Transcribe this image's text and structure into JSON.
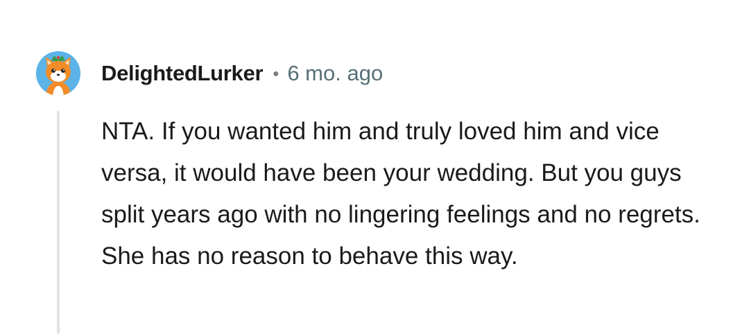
{
  "comment": {
    "author": "DelightedLurker",
    "separator": "•",
    "timestamp": "6 mo. ago",
    "avatar_icon": "orange-fox-avatar-icon",
    "body": "NTA. If you wanted him and truly loved him and vice versa, it would have been your wedding. But you guys split years ago with no lingering feelings and no regrets. She has no reason to behave this way."
  },
  "colors": {
    "author_text": "#1a1a1b",
    "timestamp_text": "#576f76",
    "thread_line": "#e2e2e2",
    "avatar_background": "#5bb3e8",
    "avatar_character": "#f28c28"
  }
}
